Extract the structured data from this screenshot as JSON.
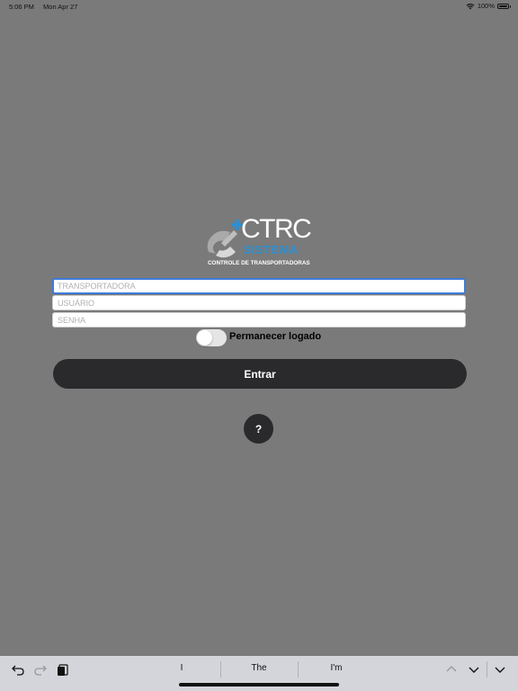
{
  "status": {
    "time": "5:06 PM",
    "date": "Mon Apr 27",
    "battery": "100%",
    "wifi_icon": "wifi-icon",
    "battery_icon": "battery-icon"
  },
  "logo": {
    "main": "CTRC",
    "sub": "SISTEMA",
    "tag": "CONTROLE DE TRANSPORTADORAS"
  },
  "form": {
    "carrier_placeholder": "TRANSPORTADORA",
    "user_placeholder": "USUÁRIO",
    "password_placeholder": "SENHA",
    "remember_label": "Permanecer logado",
    "remember_on": false,
    "login_label": "Entrar",
    "help_label": "?"
  },
  "keyboard": {
    "suggestions": [
      "I",
      "The",
      "I'm"
    ],
    "icons": [
      "undo-icon",
      "redo-icon",
      "paste-icon",
      "chevron-up-icon",
      "chevron-down-icon",
      "collapse-keyboard-icon"
    ]
  },
  "colors": {
    "background": "#7a7a7a",
    "button": "#2a2a2c",
    "brand_blue": "#2b8fd1",
    "focus": "#3d7bd9"
  }
}
